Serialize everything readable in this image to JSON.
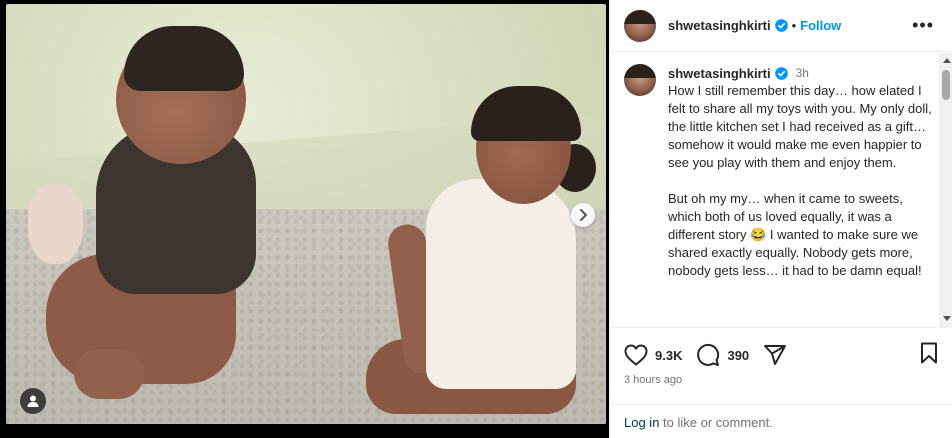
{
  "post": {
    "username": "shwetasinghkirti",
    "follow_label": "Follow",
    "separator": "•",
    "more_label": "•••",
    "verified": true,
    "caption": {
      "username": "shwetasinghkirti",
      "time": "3h",
      "text": "How I still remember this day… how elated I felt to share all my toys with you. My only doll, the little kitchen set I had received as a gift… somehow it would make me even happier to see you play with them and enjoy them.\n\nBut oh my my… when it came to sweets, which both of us loved equally, it was a different story 😂 I wanted to make sure we shared exactly equally. Nobody gets more, nobody gets less… it had to be damn equal!"
    },
    "likes": "9.3K",
    "comments_count": "390",
    "timestamp": "3 hours ago",
    "login": {
      "link": "Log in",
      "rest": " to like or comment."
    }
  },
  "icons": {
    "verified": "verified-badge-icon",
    "more": "more-options-icon",
    "like": "heart-icon",
    "comment": "comment-bubble-icon",
    "share": "share-paper-plane-icon",
    "save": "bookmark-icon",
    "next": "chevron-right-icon",
    "tags": "user-tag-icon"
  },
  "colors": {
    "accent": "#0095f6",
    "link": "#00376b",
    "verified": "#0095f6",
    "secondary_text": "#737373"
  }
}
